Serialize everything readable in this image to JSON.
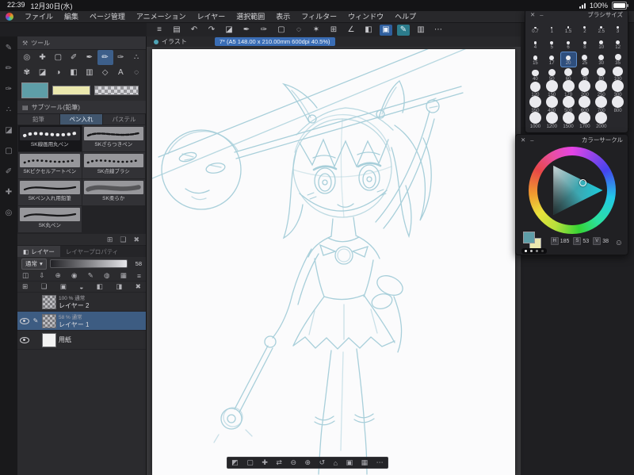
{
  "status_bar": {
    "time": "22:39",
    "date": "12月30日(水)",
    "battery": "100%"
  },
  "menu": {
    "items": [
      "ファイル",
      "編集",
      "ページ管理",
      "アニメーション",
      "レイヤー",
      "選択範囲",
      "表示",
      "フィルター",
      "ウィンドウ",
      "ヘルプ"
    ]
  },
  "toolbar": {
    "icons": [
      {
        "name": "main-menu-button",
        "glyph": "≡"
      },
      {
        "name": "workspace-button",
        "glyph": "▤"
      },
      {
        "name": "undo-button",
        "glyph": "↶"
      },
      {
        "name": "redo-button",
        "glyph": "↷"
      },
      {
        "name": "eraser-quick-button",
        "glyph": "◪"
      },
      {
        "name": "pen-quick-button",
        "glyph": "✒"
      },
      {
        "name": "brush-quick-button",
        "glyph": "✑"
      },
      {
        "name": "rect-select-button",
        "glyph": "▢"
      },
      {
        "name": "lasso-select-button",
        "glyph": "◌"
      },
      {
        "name": "auto-select-button",
        "glyph": "✶"
      },
      {
        "name": "transform-button",
        "glyph": "⊞"
      },
      {
        "name": "ruler-button",
        "glyph": "∠"
      },
      {
        "name": "fill-button",
        "glyph": "◧"
      },
      {
        "name": "selection-mode-button",
        "glyph": "▣",
        "active": "blue"
      },
      {
        "name": "draw-mode-button",
        "glyph": "✎",
        "active": "teal"
      },
      {
        "name": "material-button",
        "glyph": "▥"
      },
      {
        "name": "more-button",
        "glyph": "⋯"
      }
    ]
  },
  "edge_toolbar": {
    "icons": [
      {
        "name": "edge-pen-icon",
        "glyph": "✎"
      },
      {
        "name": "edge-pencil-icon",
        "glyph": "✏"
      },
      {
        "name": "edge-brush-icon",
        "glyph": "✑"
      },
      {
        "name": "edge-airbrush-icon",
        "glyph": "∴"
      },
      {
        "name": "edge-eraser-icon",
        "glyph": "◪"
      },
      {
        "name": "edge-select-icon",
        "glyph": "▢"
      },
      {
        "name": "edge-eyedropper-icon",
        "glyph": "✐"
      },
      {
        "name": "edge-move-icon",
        "glyph": "✚"
      },
      {
        "name": "edge-zoom-icon",
        "glyph": "◎"
      }
    ]
  },
  "document": {
    "tab_label": "イラスト",
    "title": "7* (A5 148.00 x 210.00mm 600dpi 40.5%)"
  },
  "tool_panel": {
    "title": "ツール",
    "tools": [
      {
        "name": "zoom-tool",
        "glyph": "◎"
      },
      {
        "name": "move-tool",
        "glyph": "✚"
      },
      {
        "name": "operation-tool",
        "glyph": "▢"
      },
      {
        "name": "eyedropper-tool",
        "glyph": "✐"
      },
      {
        "name": "pen-tool",
        "glyph": "✒"
      },
      {
        "name": "pencil-tool",
        "glyph": "✏",
        "active": true
      },
      {
        "name": "brush-tool",
        "glyph": "✑"
      },
      {
        "name": "airbrush-tool",
        "glyph": "∴"
      },
      {
        "name": "decoration-tool",
        "glyph": "✾"
      },
      {
        "name": "eraser-tool",
        "glyph": "◪"
      },
      {
        "name": "blend-tool",
        "glyph": "◑"
      },
      {
        "name": "fill-tool",
        "glyph": "◧"
      },
      {
        "name": "gradient-tool",
        "glyph": "▥"
      },
      {
        "name": "figure-tool",
        "glyph": "◇"
      },
      {
        "name": "text-tool",
        "glyph": "A"
      },
      {
        "name": "balloon-tool",
        "glyph": "◌"
      }
    ]
  },
  "color_swatches": {
    "main": "#5e9ea8",
    "sub": "#ebe8ae"
  },
  "subtool_panel": {
    "title": "サブツール(鉛筆)",
    "tabs": [
      {
        "label": "鉛筆",
        "active": false
      },
      {
        "label": "ペン入れ",
        "active": true
      },
      {
        "label": "パステル",
        "active": false
      }
    ],
    "brushes": [
      {
        "label": "SK線画用丸ペン",
        "selected": true,
        "stroke": "dots"
      },
      {
        "label": "SKざらつきペン",
        "selected": false,
        "stroke": "rough"
      },
      {
        "label": "SKピクセルアートペン",
        "selected": false,
        "stroke": "dotted"
      },
      {
        "label": "SK点線ブラシ",
        "selected": false,
        "stroke": "dotted"
      },
      {
        "label": "SKペン入れ用鉛筆",
        "selected": false,
        "stroke": "solid"
      },
      {
        "label": "SK柔らか",
        "selected": false,
        "stroke": "soft"
      },
      {
        "label": "SK丸ペン",
        "selected": false,
        "stroke": "solid"
      }
    ],
    "footer_icons": [
      {
        "name": "add-subtool-button",
        "glyph": "⊞"
      },
      {
        "name": "duplicate-subtool-button",
        "glyph": "❏"
      },
      {
        "name": "delete-subtool-button",
        "glyph": "✖"
      }
    ]
  },
  "layer_panel": {
    "tab_label": "レイヤー",
    "tab2_label": "レイヤープロパティ",
    "blend_mode": "通常",
    "opacity_value": "58",
    "toolbar_row1": [
      {
        "name": "palette-dock-button",
        "glyph": "◫"
      },
      {
        "name": "transfer-down-button",
        "glyph": "⇩"
      },
      {
        "name": "combine-button",
        "glyph": "⊕"
      },
      {
        "name": "reference-layer-button",
        "glyph": "◉"
      },
      {
        "name": "draw-target-button",
        "glyph": "✎"
      },
      {
        "name": "onion-skin-button",
        "glyph": "◍"
      },
      {
        "name": "tone-button",
        "glyph": "▦"
      },
      {
        "name": "layer-menu-button",
        "glyph": "≡"
      }
    ],
    "toolbar_row2": [
      {
        "name": "new-layer-button",
        "glyph": "⊞"
      },
      {
        "name": "new-folder-button",
        "glyph": "❏"
      },
      {
        "name": "duplicate-layer-button",
        "glyph": "▣"
      },
      {
        "name": "merge-down-button",
        "glyph": "◒"
      },
      {
        "name": "layer-mask-button",
        "glyph": "◧"
      },
      {
        "name": "apply-mask-button",
        "glyph": "◨"
      },
      {
        "name": "delete-layer-button",
        "glyph": "✖"
      }
    ],
    "layers": [
      {
        "name": "レイヤー 2",
        "info": "100 % 通常",
        "visible": false,
        "editing": false,
        "selected": false,
        "thumb": "checker"
      },
      {
        "name": "レイヤー 1",
        "info": "58 % 通常",
        "visible": true,
        "editing": true,
        "selected": true,
        "thumb": "checker"
      },
      {
        "name": "用紙",
        "info": "",
        "visible": true,
        "editing": false,
        "selected": false,
        "thumb": "white"
      }
    ]
  },
  "brush_size_panel": {
    "title": "ブラシサイズ",
    "selected": "20",
    "sizes": [
      "0.7",
      "1",
      "1.5",
      "2",
      "2.5",
      "3",
      "4",
      "5",
      "6",
      "8",
      "10",
      "12",
      "15",
      "17",
      "20",
      "25",
      "30",
      "35",
      "40",
      "50",
      "60",
      "70",
      "80",
      "100",
      "120",
      "150",
      "170",
      "200",
      "250",
      "300",
      "350",
      "400",
      "500",
      "600",
      "700",
      "800",
      "1000",
      "1200",
      "1500",
      "1700",
      "2000"
    ]
  },
  "color_wheel_panel": {
    "title": "カラーサークル",
    "values": [
      {
        "label": "H",
        "value": "185"
      },
      {
        "label": "S",
        "value": "53"
      },
      {
        "label": "V",
        "value": "38"
      }
    ]
  },
  "canvas_toolbar": {
    "icons": [
      {
        "name": "selection-launcher-button",
        "glyph": "◩"
      },
      {
        "name": "marquee-button",
        "glyph": "▢"
      },
      {
        "name": "move-canvas-button",
        "glyph": "✚"
      },
      {
        "name": "flip-button",
        "glyph": "⇄"
      },
      {
        "name": "zoom-out-button",
        "glyph": "⊖"
      },
      {
        "name": "zoom-in-button",
        "glyph": "⊕"
      },
      {
        "name": "rotate-reset-button",
        "glyph": "↺"
      },
      {
        "name": "fit-screen-button",
        "glyph": "⌂"
      },
      {
        "name": "actual-pixels-button",
        "glyph": "▣"
      },
      {
        "name": "grid-button",
        "glyph": "▦"
      },
      {
        "name": "canvas-more-button",
        "glyph": "⋯"
      }
    ]
  }
}
